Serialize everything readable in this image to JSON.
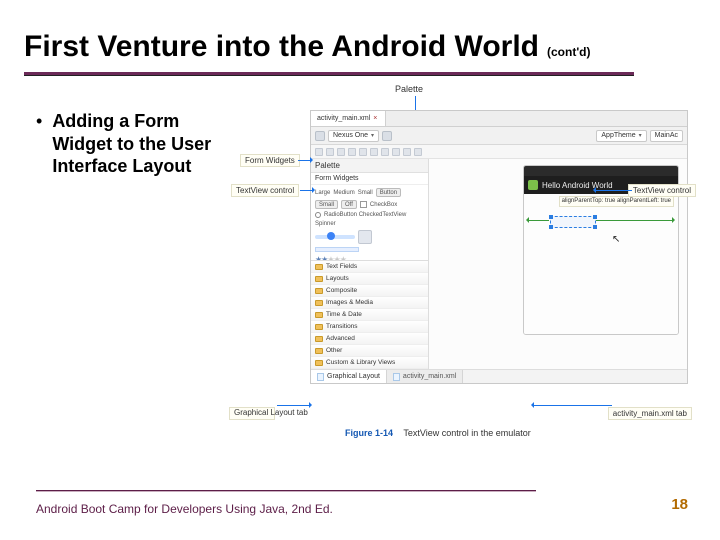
{
  "slide": {
    "title": "First Venture into the Android World",
    "contd": "(cont'd)",
    "bullet": "Adding a Form Widget to the User Interface Layout",
    "footer": "Android Boot Camp for Developers Using Java, 2nd Ed.",
    "page_number": "18"
  },
  "figure": {
    "palette_callout_top": "Palette",
    "caption_label": "Figure 1-14",
    "caption_text": "TextView control in the emulator",
    "callouts": {
      "form_widgets": "Form Widgets",
      "textview_control_left": "TextView control",
      "graphical_layout_tab": "Graphical Layout tab",
      "textview_control_right": "TextView control",
      "activity_main_tab": "activity_main.xml tab"
    }
  },
  "ide": {
    "file_tab": "activity_main.xml",
    "toolbar": {
      "device": "Nexus One",
      "theme": "AppTheme",
      "activity": "MainAc"
    },
    "palette": {
      "header": "Palette",
      "section_form_widgets": "Form Widgets",
      "btn_small": "Small",
      "btn_medium": "Medium",
      "btn_large": "Large",
      "btn_button": "Button",
      "btn_off": "Off",
      "chk_label": "CheckBox",
      "radio_label": "RadioButton CheckedTextView",
      "spinner_label": "Spinner",
      "folders": {
        "text_fields": "Text Fields",
        "layouts": "Layouts",
        "composite": "Composite",
        "images_media": "Images & Media",
        "time_date": "Time & Date",
        "transitions": "Transitions",
        "advanced": "Advanced",
        "other": "Other",
        "custom": "Custom & Library Views"
      }
    },
    "phone": {
      "app_title": "Hello Android World",
      "annotations": "alignParentTop: true\nalignParentLeft: true"
    },
    "bottom_tabs": {
      "graphical": "Graphical Layout",
      "xml": "activity_main.xml"
    }
  }
}
